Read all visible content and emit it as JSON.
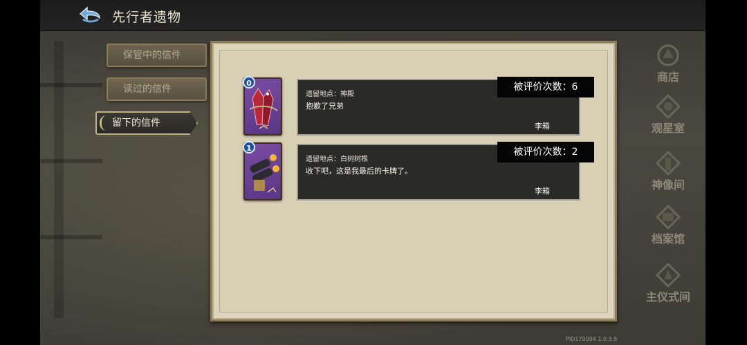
{
  "header": {
    "title": "先行者遗物"
  },
  "tabs": [
    {
      "label": "保管中的信件",
      "active": false
    },
    {
      "label": "读过的信件",
      "active": false
    },
    {
      "label": "留下的信件",
      "active": true
    }
  ],
  "letters": [
    {
      "card_cost": "0",
      "card_icon": "crimson-crystal-card-art",
      "location_line": "遗留地点：神殿",
      "message": "抱歉了兄弟",
      "author": "李箱",
      "rating_label": "被评价次数：",
      "rating_count": "6"
    },
    {
      "card_cost": "1",
      "card_icon": "twin-cannon-card-art",
      "location_line": "遗留地点：白树树根",
      "message": "收下吧，这是我最后的卡牌了。",
      "author": "李箱",
      "rating_label": "被评价次数：",
      "rating_count": "2"
    }
  ],
  "right_nav": [
    {
      "label": "商店",
      "icon": "shop-icon"
    },
    {
      "label": "观星室",
      "icon": "observatory-icon"
    },
    {
      "label": "神像间",
      "icon": "statue-icon"
    },
    {
      "label": "档案馆",
      "icon": "archive-icon"
    },
    {
      "label": "主仪式间",
      "icon": "ritual-icon"
    }
  ],
  "footer": {
    "version": "PID179094  1.0.5.5"
  },
  "colors": {
    "panel": "#d8cfb4",
    "letter_box": "#2a2a28",
    "badge": "#050505",
    "active_tab": "#2b2a26"
  }
}
